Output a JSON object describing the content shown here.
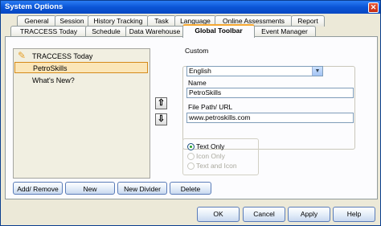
{
  "window": {
    "title": "System Options",
    "close_glyph": "✕"
  },
  "tabs_back": [
    "General",
    "Session",
    "History Tracking",
    "Task",
    "Language",
    "Online Assessments",
    "Report"
  ],
  "tabs_front": [
    "TRACCESS Today",
    "Schedule",
    "Data Warehouse",
    "Global Toolbar",
    "Event Manager"
  ],
  "active_tab": "Global Toolbar",
  "toolbar_list": {
    "items": [
      {
        "label": "TRACCESS Today",
        "icon": "star-icon",
        "selected": false
      },
      {
        "label": "PetroSkills",
        "icon": "",
        "selected": true
      },
      {
        "label": "What's New?",
        "icon": "",
        "selected": false
      }
    ]
  },
  "list_buttons": {
    "add_remove": "Add/ Remove",
    "new": "New",
    "new_divider": "New Divider",
    "delete": "Delete"
  },
  "move_buttons": {
    "up_glyph": "⇧",
    "down_glyph": "⇩"
  },
  "custom": {
    "label": "Custom",
    "language_value": "English",
    "name_label": "Name",
    "name_value": "PetroSkills",
    "path_label": "File Path/ URL",
    "path_value": "www.petroskills.com"
  },
  "display": {
    "options": [
      {
        "label": "Text Only",
        "checked": true,
        "enabled": true
      },
      {
        "label": "Icon Only",
        "checked": false,
        "enabled": false
      },
      {
        "label": "Text and Icon",
        "checked": false,
        "enabled": false
      }
    ]
  },
  "footer": {
    "ok": "OK",
    "cancel": "Cancel",
    "apply": "Apply",
    "help": "Help"
  },
  "colors": {
    "titlebar": "#0a55d6",
    "selection": "#fbe6b8",
    "active_tab_accent": "#f5a732"
  }
}
